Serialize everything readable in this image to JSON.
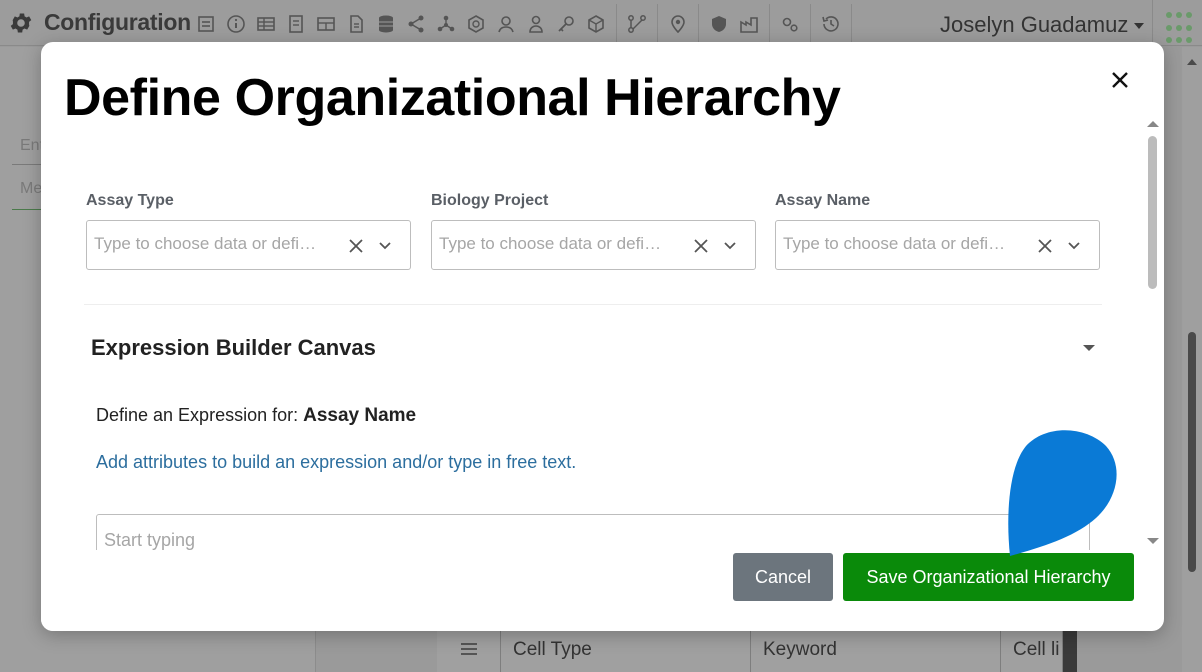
{
  "app": {
    "title": "Configuration",
    "user_name": "Joselyn Guadamuz",
    "toolbar_icons": [
      "form-icon",
      "info-icon",
      "table-icon",
      "document-icon",
      "layout-icon",
      "file-icon",
      "database-icon",
      "share-icon",
      "network-icon",
      "hexagon-icon",
      "user-icon",
      "person-icon",
      "key-icon",
      "cube-icon",
      "workflow-icon",
      "location-icon",
      "shield-icon",
      "factory-icon",
      "settings-icon",
      "history-icon"
    ]
  },
  "background": {
    "input1_value": "Ent",
    "input2_value": "Me",
    "table_row": [
      "Cell Type",
      "Keyword",
      "Cell li"
    ]
  },
  "modal": {
    "title": "Define Organizational Hierarchy",
    "fields": [
      {
        "label": "Assay Type",
        "placeholder": "Type to choose data or defi…"
      },
      {
        "label": "Biology Project",
        "placeholder": "Type to choose data or defi…"
      },
      {
        "label": "Assay Name",
        "placeholder": "Type to choose data or defi…"
      }
    ],
    "section_title": "Expression Builder Canvas",
    "expression_prefix": "Define an Expression for: ",
    "expression_target": "Assay Name",
    "hint": "Add attributes to build an expression and/or type in free text.",
    "expression_placeholder": "Start typing",
    "cancel_label": "Cancel",
    "save_label": "Save Organizational Hierarchy"
  },
  "colors": {
    "save_button": "#0a8a0a",
    "cancel_button": "#6c757d",
    "hint_link": "#2c6e9e",
    "cursor_drop": "#0a7ad6"
  }
}
